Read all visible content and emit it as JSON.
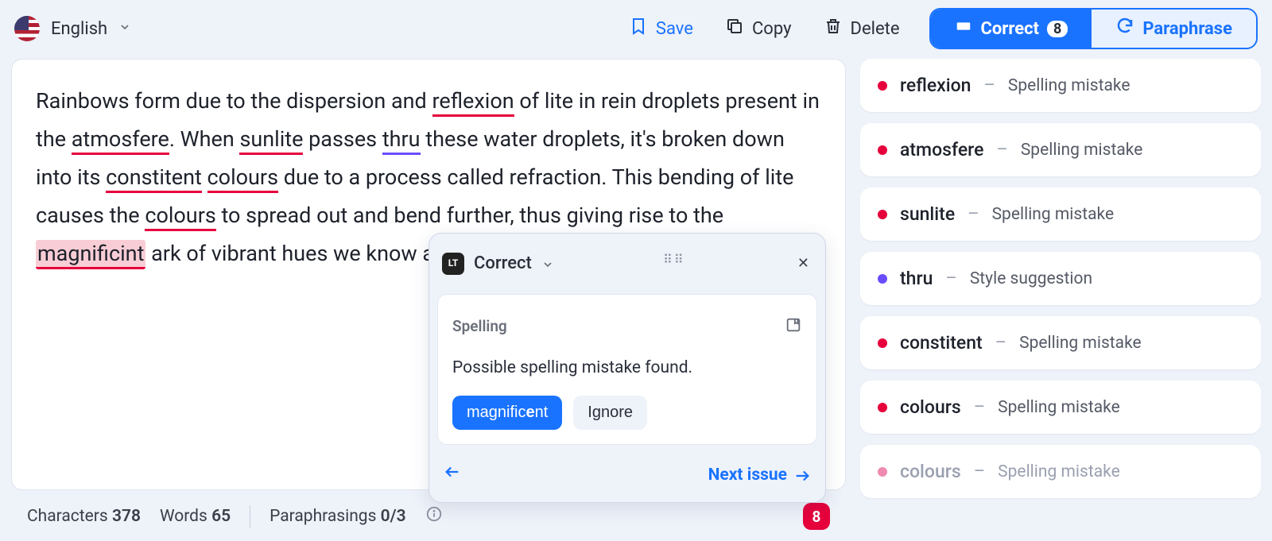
{
  "header": {
    "language": "English",
    "save": "Save",
    "copy": "Copy",
    "delete": "Delete"
  },
  "tabs": {
    "correct_label": "Correct",
    "correct_count": "8",
    "paraphrase_label": "Paraphrase"
  },
  "editor_text": {
    "p1a": "Rainbows form due to the dispersion and ",
    "w_reflexion": "reflexion",
    "p1b": " of lite in rein droplets present in the ",
    "w_atmosfere": "atmosfere",
    "p1c": ". When ",
    "w_sunlite": "sunlite",
    "p1d": " passes ",
    "w_thru": "thru",
    "p1e": " these water droplets, it's broken down into its ",
    "w_constitent": "constitent",
    "sp": " ",
    "w_colours1": "colours",
    "p1f": " due to a process called refraction. This bending of lite causes the ",
    "w_colours2": "colours",
    "p1g": " to spread out and bend further, thus giving rise to the ",
    "w_magnificint": "magnificint",
    "p1h": " ark of vibrant hues we know as a rainbow."
  },
  "popup": {
    "logo": "LT",
    "title": "Correct",
    "category": "Spelling",
    "message": "Possible spelling mistake found.",
    "suggestion_prefix": "magnific",
    "suggestion_bold": "e",
    "suggestion_suffix": "nt",
    "ignore": "Ignore",
    "next": "Next issue"
  },
  "issues": [
    {
      "word": "reflexion",
      "type": "Spelling mistake",
      "color": "red",
      "faded": false
    },
    {
      "word": "atmosfere",
      "type": "Spelling mistake",
      "color": "red",
      "faded": false
    },
    {
      "word": "sunlite",
      "type": "Spelling mistake",
      "color": "red",
      "faded": false
    },
    {
      "word": "thru",
      "type": "Style suggestion",
      "color": "purple",
      "faded": false
    },
    {
      "word": "constitent",
      "type": "Spelling mistake",
      "color": "red",
      "faded": false
    },
    {
      "word": "colours",
      "type": "Spelling mistake",
      "color": "red",
      "faded": false
    },
    {
      "word": "colours",
      "type": "Spelling mistake",
      "color": "pink",
      "faded": true
    }
  ],
  "status": {
    "chars_label": "Characters",
    "chars_value": "378",
    "words_label": "Words",
    "words_value": "65",
    "para_label": "Paraphrasings",
    "para_value": "0/3",
    "error_count": "8"
  }
}
